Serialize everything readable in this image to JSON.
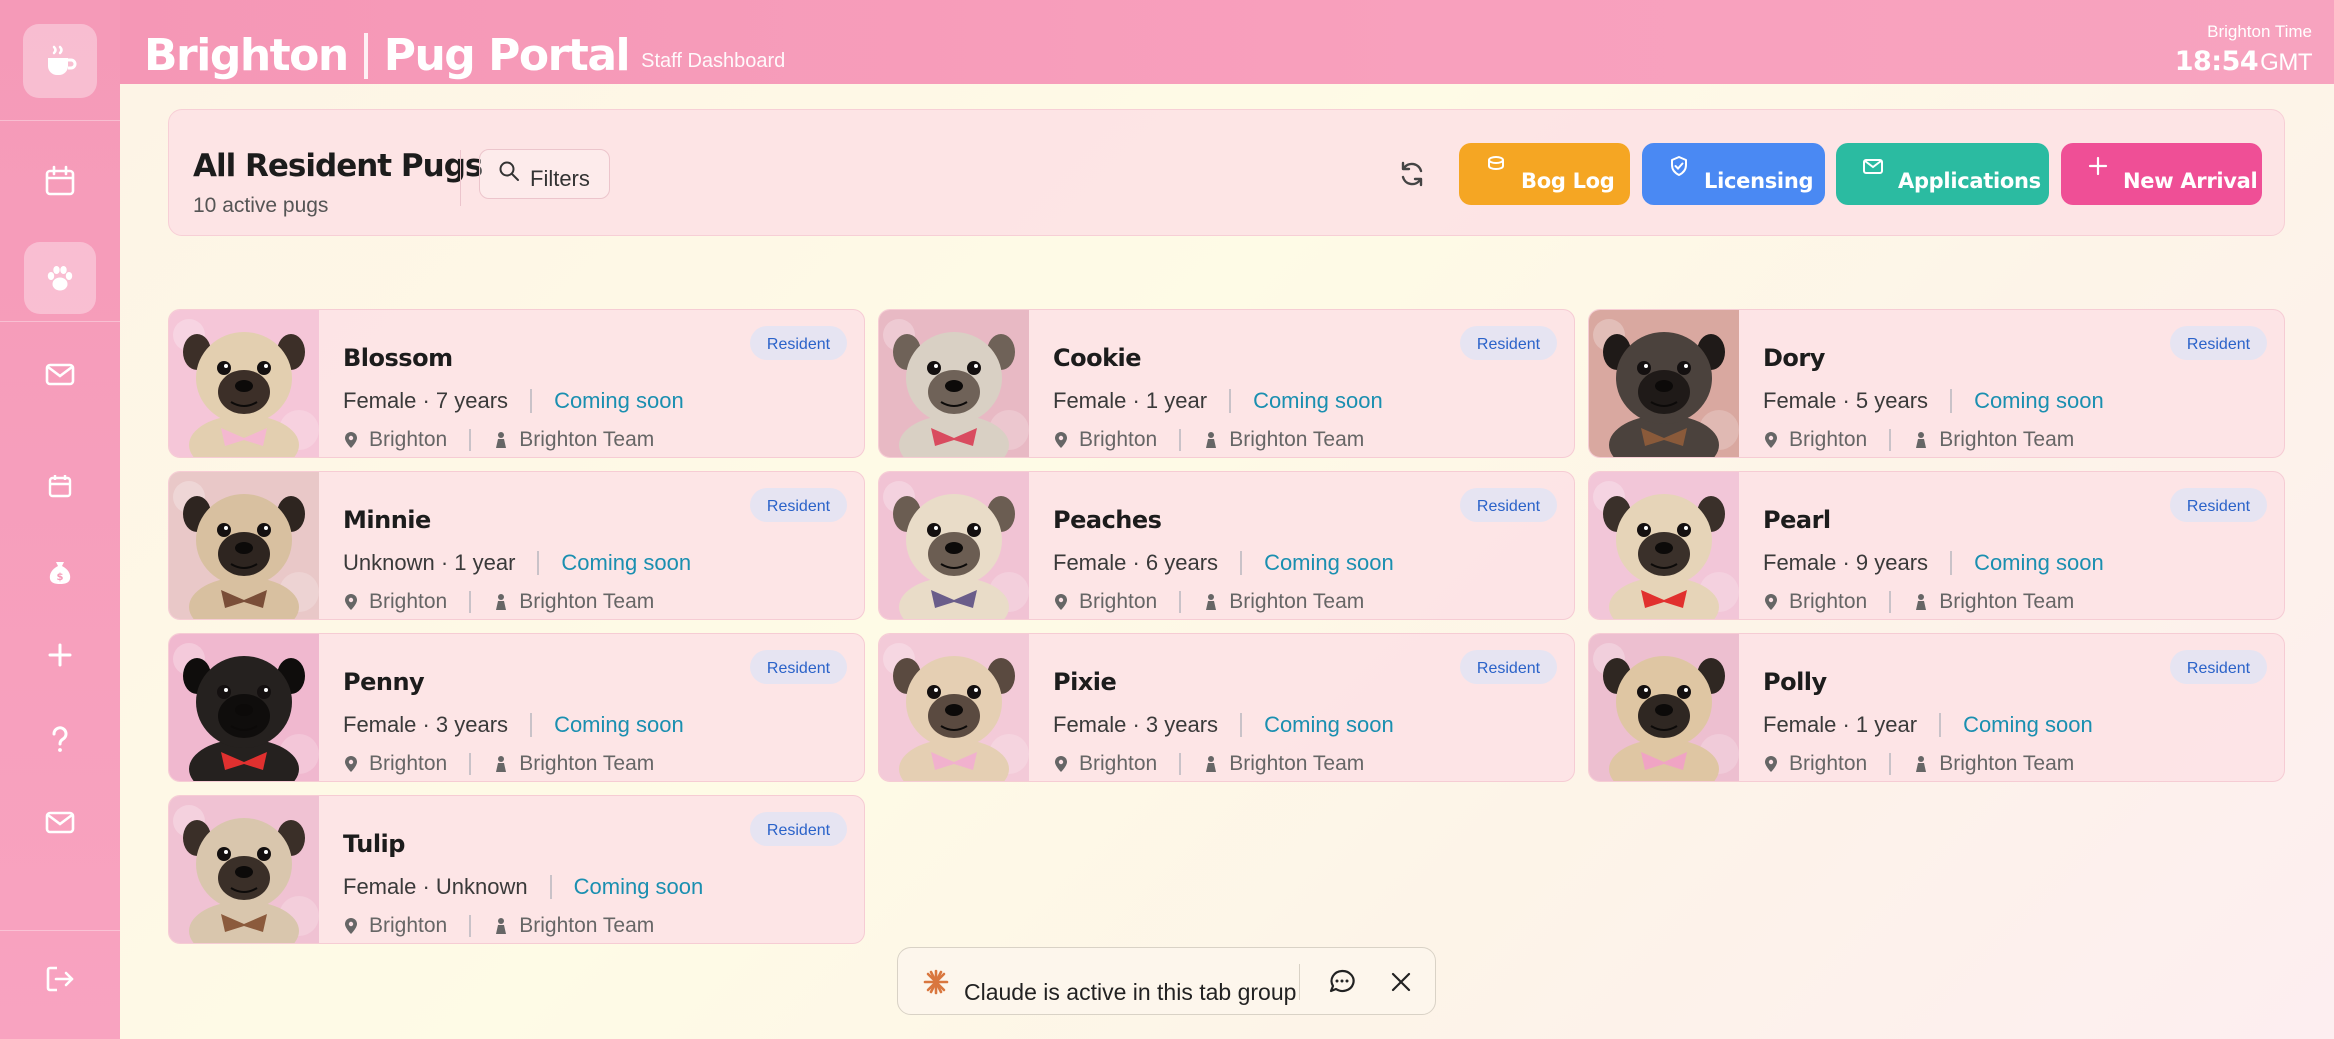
{
  "header": {
    "brand_left": "Brighton",
    "brand_right": "Pug Portal",
    "subtitle": "Staff Dashboard",
    "clock_label": "Brighton Time",
    "clock_time": "18:54",
    "clock_tz": "GMT"
  },
  "sidebar": {
    "items": [
      {
        "icon": "calendar-icon"
      },
      {
        "icon": "paw-icon",
        "active": true
      },
      {
        "icon": "mail-icon"
      },
      {
        "icon": "calendar-small-icon"
      },
      {
        "icon": "money-bag-icon"
      },
      {
        "icon": "plus-icon"
      },
      {
        "icon": "help-icon"
      },
      {
        "icon": "mail-icon"
      },
      {
        "icon": "logout-icon"
      }
    ]
  },
  "toolbar": {
    "title": "All Resident Pugs",
    "count": "10 active pugs",
    "filters_label": "Filters",
    "buttons": {
      "bog_log": "Bog Log",
      "licensing": "Licensing",
      "applications": "Applications",
      "new_arrival": "New Arrival"
    }
  },
  "pugs": [
    {
      "name": "Blossom",
      "info": "Female · 7 years",
      "status": "Coming soon",
      "badge": "Resident",
      "location": "Brighton",
      "team": "Brighton Team"
    },
    {
      "name": "Cookie",
      "info": "Female · 1 year",
      "status": "Coming soon",
      "badge": "Resident",
      "location": "Brighton",
      "team": "Brighton Team"
    },
    {
      "name": "Dory",
      "info": "Female · 5 years",
      "status": "Coming soon",
      "badge": "Resident",
      "location": "Brighton",
      "team": "Brighton Team"
    },
    {
      "name": "Minnie",
      "info": "Unknown · 1 year",
      "status": "Coming soon",
      "badge": "Resident",
      "location": "Brighton",
      "team": "Brighton Team"
    },
    {
      "name": "Peaches",
      "info": "Female · 6 years",
      "status": "Coming soon",
      "badge": "Resident",
      "location": "Brighton",
      "team": "Brighton Team"
    },
    {
      "name": "Pearl",
      "info": "Female · 9 years",
      "status": "Coming soon",
      "badge": "Resident",
      "location": "Brighton",
      "team": "Brighton Team"
    },
    {
      "name": "Penny",
      "info": "Female · 3 years",
      "status": "Coming soon",
      "badge": "Resident",
      "location": "Brighton",
      "team": "Brighton Team"
    },
    {
      "name": "Pixie",
      "info": "Female · 3 years",
      "status": "Coming soon",
      "badge": "Resident",
      "location": "Brighton",
      "team": "Brighton Team"
    },
    {
      "name": "Polly",
      "info": "Female · 1 year",
      "status": "Coming soon",
      "badge": "Resident",
      "location": "Brighton",
      "team": "Brighton Team"
    },
    {
      "name": "Tulip",
      "info": "Female · Unknown",
      "status": "Coming soon",
      "badge": "Resident",
      "location": "Brighton",
      "team": "Brighton Team"
    }
  ],
  "claude_bar": {
    "text": "Claude is active in this tab group"
  },
  "colors": {
    "sidebar": "#f59ab8",
    "header": "#f597b6",
    "bog_log": "#f5a623",
    "licensing": "#4a89f3",
    "applications": "#2bbba1",
    "new_arrival": "#ef4f96",
    "coming_soon": "#1a8fb0",
    "badge_text": "#2a62c9"
  }
}
